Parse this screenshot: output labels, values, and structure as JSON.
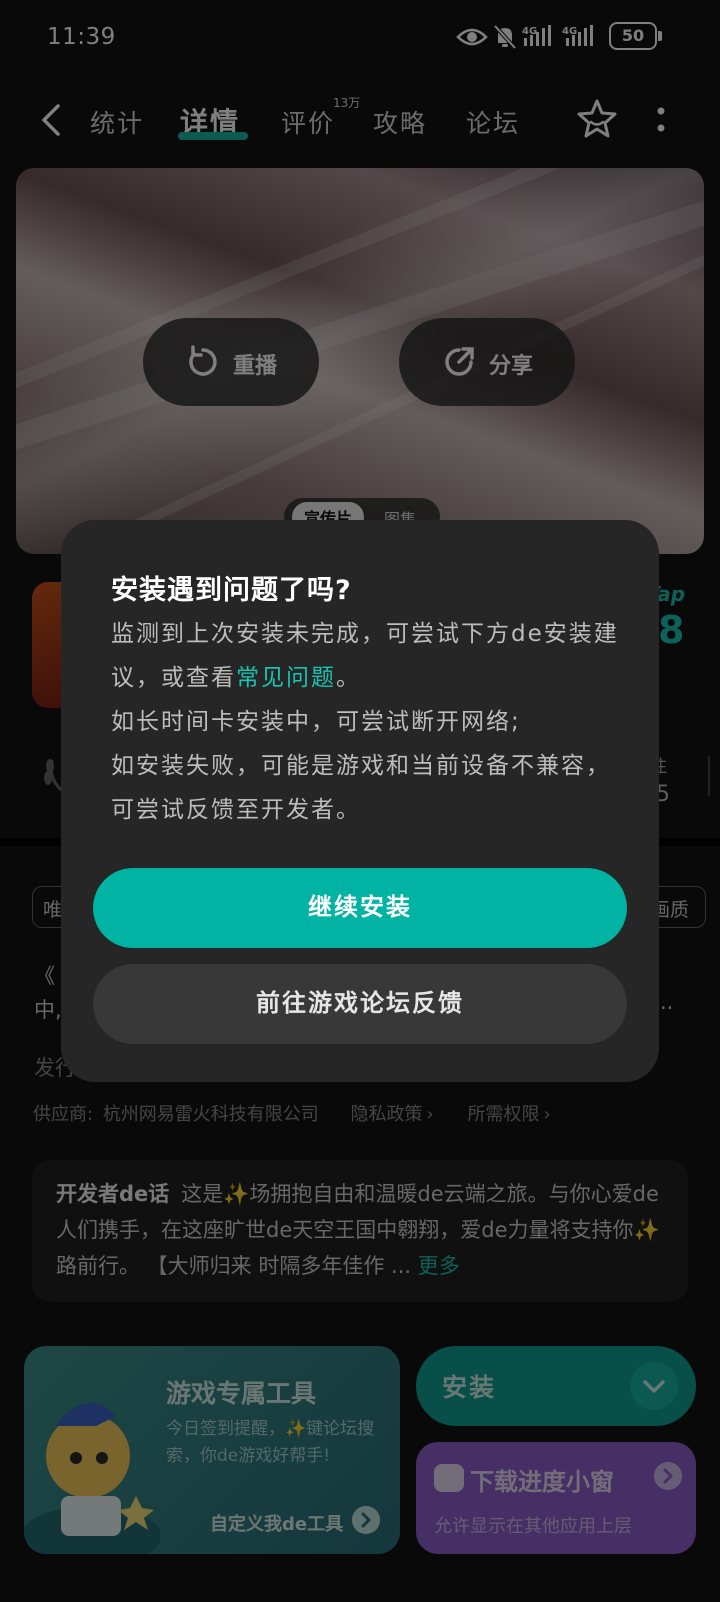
{
  "status_bar": {
    "time": "11:39",
    "battery": "50",
    "network_1": "4G",
    "network_2": "4G"
  },
  "nav": {
    "tabs": [
      {
        "label": "统计"
      },
      {
        "label": "详情",
        "active": true
      },
      {
        "label": "评价",
        "badge": "13万"
      },
      {
        "label": "攻略"
      },
      {
        "label": "论坛"
      }
    ],
    "accent": "#14b8a6"
  },
  "video": {
    "replay_label": "重播",
    "share_label": "分享",
    "media_tabs": [
      "宣传片",
      "图集"
    ]
  },
  "background_info": {
    "tap_label": "Tap",
    "tap_score": "8",
    "follow_label": "注",
    "follow_value": "5",
    "chip_left": "唯",
    "chip_right": "画质",
    "desc_line1": "《",
    "desc_line2": "中,",
    "desc_ellipsis": "..",
    "publisher_label": "发行",
    "supplier_label": "供应商:",
    "supplier_name": "杭州网易雷火科技有限公司",
    "privacy_link": "隐私政策",
    "permissions_link": "所需权限"
  },
  "developer_note": {
    "label": "开发者de话",
    "text": "这是✨场拥抱自由和温暖de云端之旅。与你心爱de人们携手，在这座旷世de天空王国中翱翔，爱de力量将支持你✨路前行。 【大师归来 时隔多年佳作 ...",
    "more": "更多"
  },
  "tool_card": {
    "title": "游戏专属工具",
    "subtitle": "今日签到提醒，✨键论坛搜索，你de游戏好帮手!",
    "link": "自定义我de工具"
  },
  "install": {
    "label": "安装"
  },
  "download_card": {
    "title": "下载进度小窗",
    "subtitle": "允许显示在其他应用上层"
  },
  "dialog": {
    "title": "安装遇到问题了吗?",
    "body_1": "监测到上次安装未完成，可尝试下方de安装建议，或查看",
    "faq_link": "常见问题",
    "body_2": "。",
    "body_3": "如长时间卡安装中，可尝试断开网络;",
    "body_4": "如安装失败，可能是游戏和当前设备不兼容，可尝试反馈至开发者。",
    "primary_button": "继续安装",
    "secondary_button": "前往游戏论坛反馈",
    "primary_color": "#00b3a2"
  }
}
